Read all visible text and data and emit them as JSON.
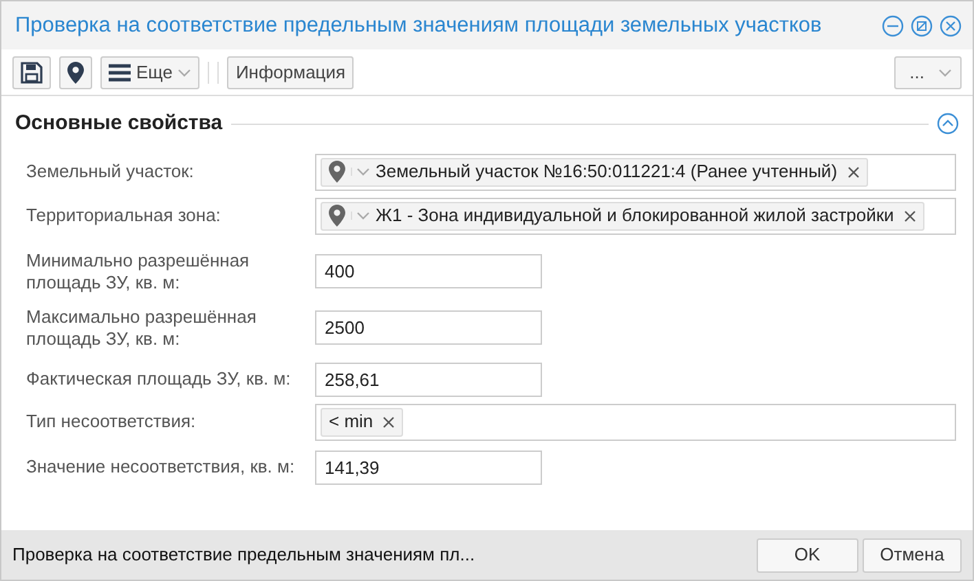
{
  "window": {
    "title": "Проверка на соответствие предельным значениям площади земельных участков"
  },
  "toolbar": {
    "more_label": "Еще",
    "info_button": "Информация",
    "overflow_label": "..."
  },
  "section": {
    "title": "Основные свойства",
    "expanded": true
  },
  "fields": [
    {
      "kind": "reference",
      "label": "Земельный участок:",
      "tags": [
        "Земельный участок №16:50:011221:4 (Ранее учтенный)"
      ]
    },
    {
      "kind": "reference",
      "label": "Территориальная зона:",
      "tags": [
        "Ж1 - Зона индивидуальной и блокированной жилой застройки"
      ]
    },
    {
      "kind": "text",
      "label": "Минимально разрешённая площадь ЗУ, кв. м:",
      "value": "400"
    },
    {
      "kind": "text",
      "label": "Максимально разрешённая площадь ЗУ, кв. м:",
      "value": "2500"
    },
    {
      "kind": "text",
      "label": "Фактическая площадь ЗУ, кв. м:",
      "value": "258,61"
    },
    {
      "kind": "tags",
      "label": "Тип несоответствия:",
      "tags": [
        "< min"
      ]
    },
    {
      "kind": "text",
      "label": "Значение несоответствия, кв. м:",
      "value": "141,39"
    }
  ],
  "status_bar": {
    "text": "Проверка на соответствие предельным значениям пл...",
    "buttons": [
      "OK",
      "Отмена"
    ]
  }
}
